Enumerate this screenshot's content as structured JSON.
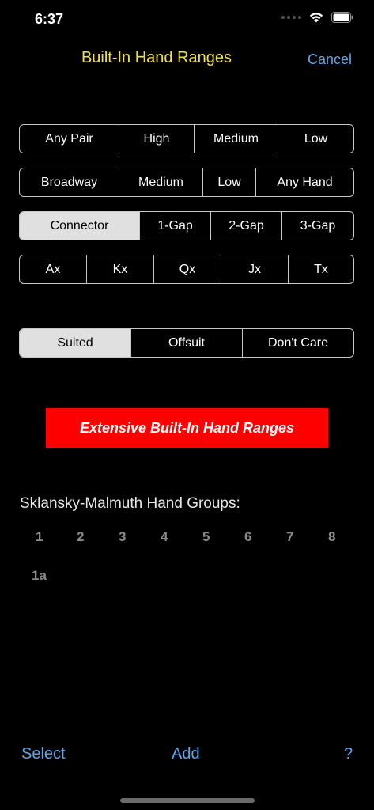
{
  "status": {
    "time": "6:37"
  },
  "nav": {
    "title": "Built-In Hand Ranges",
    "cancel": "Cancel"
  },
  "segments": {
    "pairs": [
      "Any Pair",
      "High",
      "Medium",
      "Low"
    ],
    "broadway": [
      "Broadway",
      "Medium",
      "Low",
      "Any Hand"
    ],
    "gaps": [
      "Connector",
      "1-Gap",
      "2-Gap",
      "3-Gap"
    ],
    "aces": [
      "Ax",
      "Kx",
      "Qx",
      "Jx",
      "Tx"
    ],
    "suit": [
      "Suited",
      "Offsuit",
      "Don't Care"
    ]
  },
  "selected": {
    "gaps": "Connector",
    "suit": "Suited"
  },
  "promo": {
    "label": "Extensive Built-In Hand Ranges",
    "color": "#ff0000"
  },
  "groups": {
    "title": "Sklansky-Malmuth Hand Groups:",
    "items": [
      "1",
      "2",
      "3",
      "4",
      "5",
      "6",
      "7",
      "8",
      "1a"
    ]
  },
  "toolbar": {
    "select": "Select",
    "add": "Add",
    "help": "?"
  },
  "colors": {
    "title": "#f2e33a",
    "link": "#5aa8ea",
    "background": "#000000"
  }
}
